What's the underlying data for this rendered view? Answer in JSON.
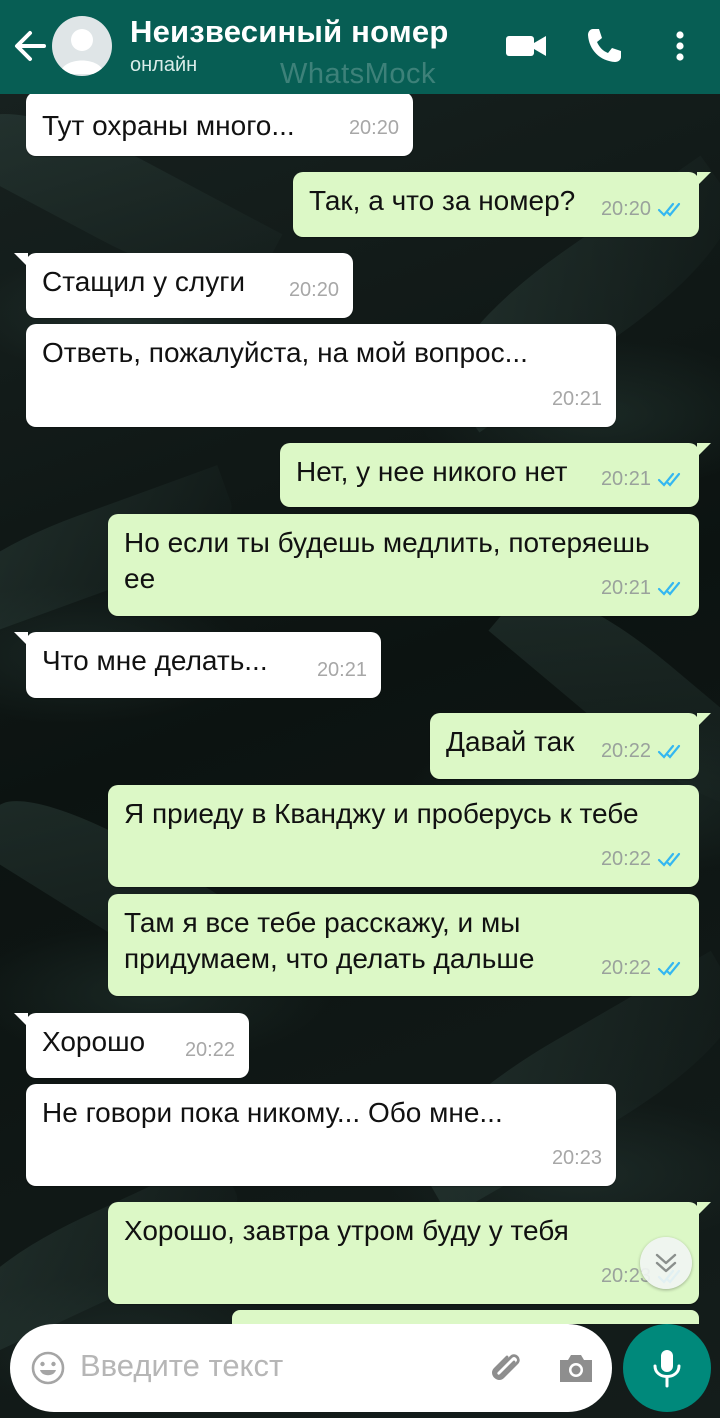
{
  "header": {
    "contact_name": "Неизвесиный номер",
    "status": "онлайн",
    "watermark": "WhatsMock",
    "back_icon": "arrow-left-icon",
    "video_icon": "video-camera-icon",
    "call_icon": "phone-icon",
    "menu_icon": "more-vertical-icon"
  },
  "messages": [
    {
      "dir": "in",
      "text": "Тут охраны много...",
      "time": "20:20"
    },
    {
      "dir": "out",
      "text": "Так, а что за номер?",
      "time": "20:20",
      "read": true
    },
    {
      "dir": "in",
      "text": "Стащил у слуги",
      "time": "20:20"
    },
    {
      "dir": "in",
      "text": "Ответь, пожалуйста, на мой вопрос...",
      "time": "20:21"
    },
    {
      "dir": "out",
      "text": "Нет, у нее никого нет",
      "time": "20:21",
      "read": true
    },
    {
      "dir": "out",
      "text": "Но если ты будешь медлить, потеряешь ее",
      "time": "20:21",
      "read": true
    },
    {
      "dir": "in",
      "text": "Что мне делать...",
      "time": "20:21"
    },
    {
      "dir": "out",
      "text": "Давай так",
      "time": "20:22",
      "read": true
    },
    {
      "dir": "out",
      "text": "Я приеду в Кванджу и проберусь к тебе",
      "time": "20:22",
      "read": true
    },
    {
      "dir": "out",
      "text": "Там я все тебе расскажу, и мы придумаем, что делать дальше",
      "time": "20:22",
      "read": true
    },
    {
      "dir": "in",
      "text": "Хорошо",
      "time": "20:22"
    },
    {
      "dir": "in",
      "text": "Не говори пока никому... Обо мне...",
      "time": "20:23"
    },
    {
      "dir": "out",
      "text": "Хорошо, завтра утром буду у тебя",
      "time": "20:23",
      "read": true
    }
  ],
  "composer": {
    "placeholder": "Введите текст",
    "emoji_icon": "emoji-icon",
    "attach_icon": "paperclip-icon",
    "camera_icon": "camera-icon",
    "mic_icon": "microphone-icon"
  },
  "colors": {
    "header": "#075e54",
    "outgoing_bubble": "#dcf8c6",
    "incoming_bubble": "#ffffff",
    "read_ticks": "#34b7f1",
    "mic_button": "#00897b"
  }
}
